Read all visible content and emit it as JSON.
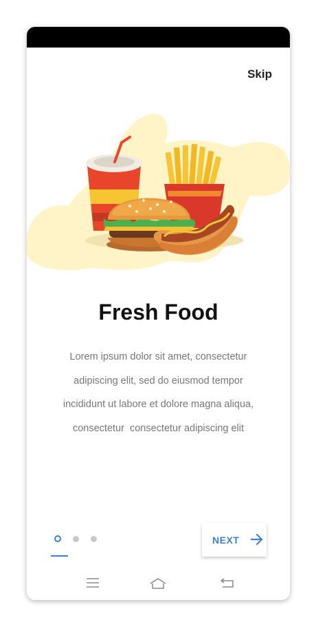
{
  "header": {
    "skip_label": "Skip"
  },
  "onboarding": {
    "title": "Fresh Food",
    "description_lines": [
      "Lorem ipsum dolor sit amet, consectetur",
      "adipiscing elit, sed do eiusmod tempor",
      "incididunt ut labore et dolore magna aliqua,",
      "consectetur  consectetur adipiscing elit"
    ],
    "illustration": "fast-food-illustration"
  },
  "pager": {
    "total_pages": 3,
    "current_page": 1
  },
  "footer": {
    "next_label": "NEXT",
    "next_icon": "arrow-right-icon"
  },
  "nav_bar": {
    "icons": [
      "menu-icon",
      "home-icon",
      "back-icon"
    ]
  },
  "colors": {
    "accent": "#3f7fd9",
    "blob": "#fff3c8",
    "title": "#111111",
    "text": "#777777",
    "status_bar": "#000000"
  }
}
